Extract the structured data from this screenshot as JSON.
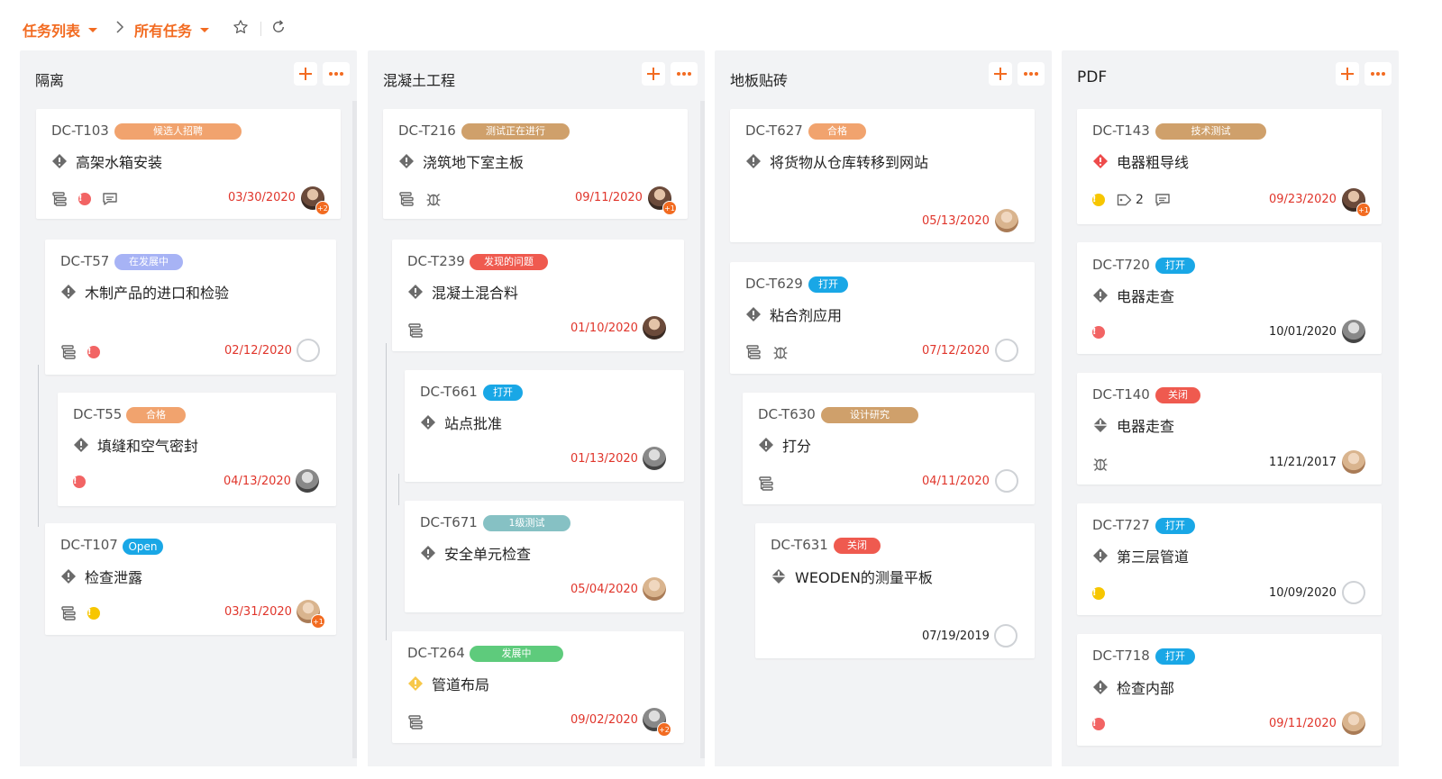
{
  "breadcrumb": {
    "task_list": "任务列表",
    "all_tasks": "所有任务"
  },
  "colors": {
    "accent": "#f26b21",
    "badge_orange": "#f1a36e",
    "badge_tan": "#cfa06b",
    "badge_lavender": "#a7b3f5",
    "badge_blue": "#19a7e6",
    "badge_red": "#ef5a4f",
    "badge_teal": "#86c1c4",
    "badge_green": "#5ecb7c",
    "date_red": "#e0352b"
  },
  "columns": [
    {
      "title": "隔离",
      "cards": [
        {
          "id": "DC-T103",
          "badge": "候选人招聘",
          "title": "高架水箱安装",
          "date": "03/30/2020",
          "extra": "+2"
        },
        {
          "id": "DC-T57",
          "badge": "在发展中",
          "title": "木制产品的进口和检验",
          "date": "02/12/2020"
        },
        {
          "id": "DC-T55",
          "badge": "合格",
          "title": "填缝和空气密封",
          "date": "04/13/2020"
        },
        {
          "id": "DC-T107",
          "badge": "Open",
          "title": "检查泄露",
          "date": "03/31/2020",
          "extra": "+1"
        }
      ]
    },
    {
      "title": "混凝土工程",
      "cards": [
        {
          "id": "DC-T216",
          "badge": "测试正在进行",
          "title": "浇筑地下室主板",
          "date": "09/11/2020",
          "extra": "+1"
        },
        {
          "id": "DC-T239",
          "badge": "发现的问题",
          "title": "混凝土混合料",
          "date": "01/10/2020"
        },
        {
          "id": "DC-T661",
          "badge": "打开",
          "title": "站点批准",
          "date": "01/13/2020"
        },
        {
          "id": "DC-T671",
          "badge": "1级测试",
          "title": "安全单元检查",
          "date": "05/04/2020"
        },
        {
          "id": "DC-T264",
          "badge": "发展中",
          "title": "管道布局",
          "date": "09/02/2020",
          "extra": "+2"
        }
      ]
    },
    {
      "title": "地板贴砖",
      "cards": [
        {
          "id": "DC-T627",
          "badge": "合格",
          "title": "将货物从仓库转移到网站",
          "date": "05/13/2020"
        },
        {
          "id": "DC-T629",
          "badge": "打开",
          "title": "粘合剂应用",
          "date": "07/12/2020"
        },
        {
          "id": "DC-T630",
          "badge": "设计研究",
          "title": "打分",
          "date": "04/11/2020"
        },
        {
          "id": "DC-T631",
          "badge": "关闭",
          "title": "WEODEN的测量平板",
          "date": "07/19/2019"
        }
      ]
    },
    {
      "title": "PDF",
      "cards": [
        {
          "id": "DC-T143",
          "badge": "技术测试",
          "title": "电器粗导线",
          "date": "09/23/2020",
          "tag_count": "2",
          "extra": "+1"
        },
        {
          "id": "DC-T720",
          "badge": "打开",
          "title": "电器走查",
          "date": "10/01/2020"
        },
        {
          "id": "DC-T140",
          "badge": "关闭",
          "title": "电器走查",
          "date": "11/21/2017"
        },
        {
          "id": "DC-T727",
          "badge": "打开",
          "title": "第三层管道",
          "date": "10/09/2020"
        },
        {
          "id": "DC-T718",
          "badge": "打开",
          "title": "检查内部",
          "date": "09/11/2020"
        }
      ]
    }
  ]
}
